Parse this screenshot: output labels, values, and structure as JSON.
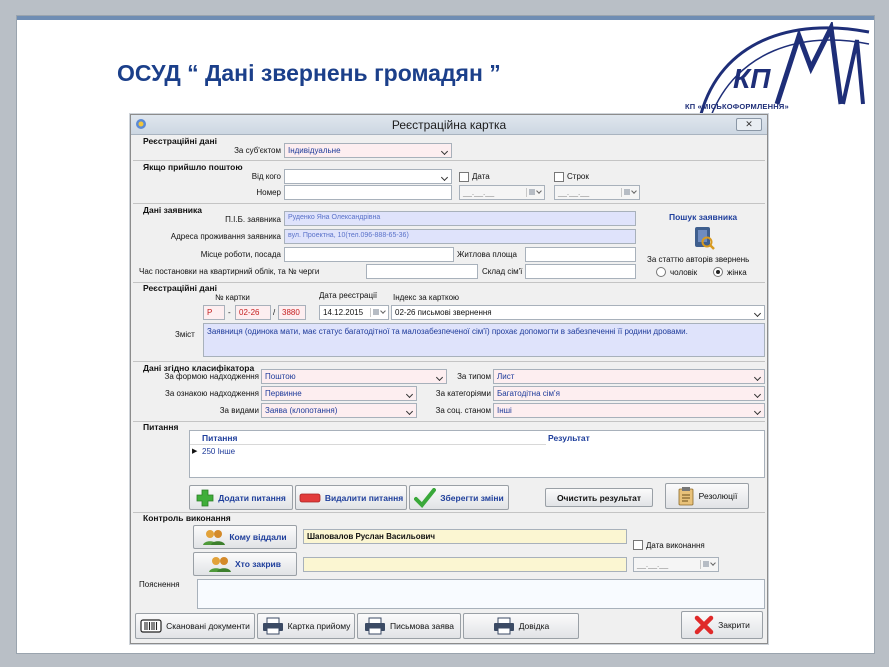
{
  "slide": {
    "title": "ОСУД “ Дані звернень громадян ”",
    "logo_mark": "КП",
    "logo_caption": "КП «МІСЬКОФОРМЛЕННЯ»",
    "colors": {
      "title": "#1b3f8a",
      "logo": "#1e2e78",
      "bar": "#6f8db3"
    }
  },
  "window": {
    "title": "Реєстраційна картка",
    "close_label": "✕"
  },
  "reg": {
    "section": "Реєстраційні дані",
    "subject_label": "За суб'єктом",
    "subject_value": "Індивідуальне"
  },
  "mail": {
    "section": "Якщо прийшло поштою",
    "from_label": "Від кого",
    "from_value": "",
    "number_label": "Номер",
    "number_value": "",
    "date_label": "Дата",
    "date_value": "__.__.__",
    "term_label": "Строк",
    "term_value": "__.__.__"
  },
  "applicant": {
    "section": "Дані заявника",
    "name_label": "П.І.Б. заявника",
    "name_value": "Руденко Яна Олександрівна",
    "address_label": "Адреса проживання заявника",
    "address_value": "вул. Проектна, 10(тел.096-888-65-36)",
    "work_label": "Місце роботи, посада",
    "work_value": "",
    "living_area_label": "Житлова площа",
    "living_area_value": "",
    "queue_label": "Час постановки на квартирний облік, та № черги",
    "queue_value": "",
    "family_label": "Склад сім'ї",
    "family_value": "",
    "search_label": "Пошук заявника",
    "gender_label": "За статтю авторів звернень",
    "gender_male": "чоловік",
    "gender_female": "жінка",
    "gender_selected": "жінка"
  },
  "card": {
    "section": "Реєстраційні дані",
    "card_no_label": "№ картки",
    "card_prefix": "Р",
    "card_dash": "-",
    "card_index": "02-26",
    "card_slash": "/",
    "card_number": "3880",
    "date_label": "Дата реєстрації",
    "date_value": "14.12.2015",
    "index_label": "Індекс за карткою",
    "index_value": "02-26 письмові звернення",
    "content_label": "Зміст",
    "content_value": "Заявниця (одинока мати, має статус багатодітної та малозабезпеченої сім'ї) прохає допомогти в забезпеченні її родини дровами."
  },
  "classifier": {
    "section": "Дані згідно класифікатора",
    "form_label": "За формою надходження",
    "form_value": "Поштою",
    "type_label": "За типом",
    "type_value": "Лист",
    "sign_label": "За ознакою надходження",
    "sign_value": "Первинне",
    "category_label": "За категоріями",
    "category_value": "Багатодітна сім'я",
    "kind_label": "За видами",
    "kind_value": "Заява (клопотання)",
    "social_label": "За соц. станом",
    "social_value": "Інші"
  },
  "questions": {
    "section": "Питання",
    "col_question": "Питання",
    "col_result": "Результат",
    "rows": [
      {
        "question": "250 Інше",
        "result": ""
      }
    ],
    "add_button": "Додати питання",
    "delete_button": "Видалити питання",
    "save_button": "Зберегти зміни",
    "clear_button": "Очистить результат",
    "resolutions_button": "Резолюції"
  },
  "control": {
    "section": "Контроль виконання",
    "to_whom_button": "Кому віддали",
    "to_whom_value": "Шаповалов Руслан Васильович",
    "closed_by_button": "Хто закрив",
    "closed_by_value": "",
    "exec_date_label": "Дата виконання",
    "exec_date_value": "__.__.__",
    "notes_label": "Пояснення",
    "notes_value": ""
  },
  "footer": {
    "scanned_button": "Скановані документи",
    "reception_button": "Картка прийому",
    "written_button": "Письмова заява",
    "reference_button": "Довідка",
    "close_button": "Закрити"
  }
}
